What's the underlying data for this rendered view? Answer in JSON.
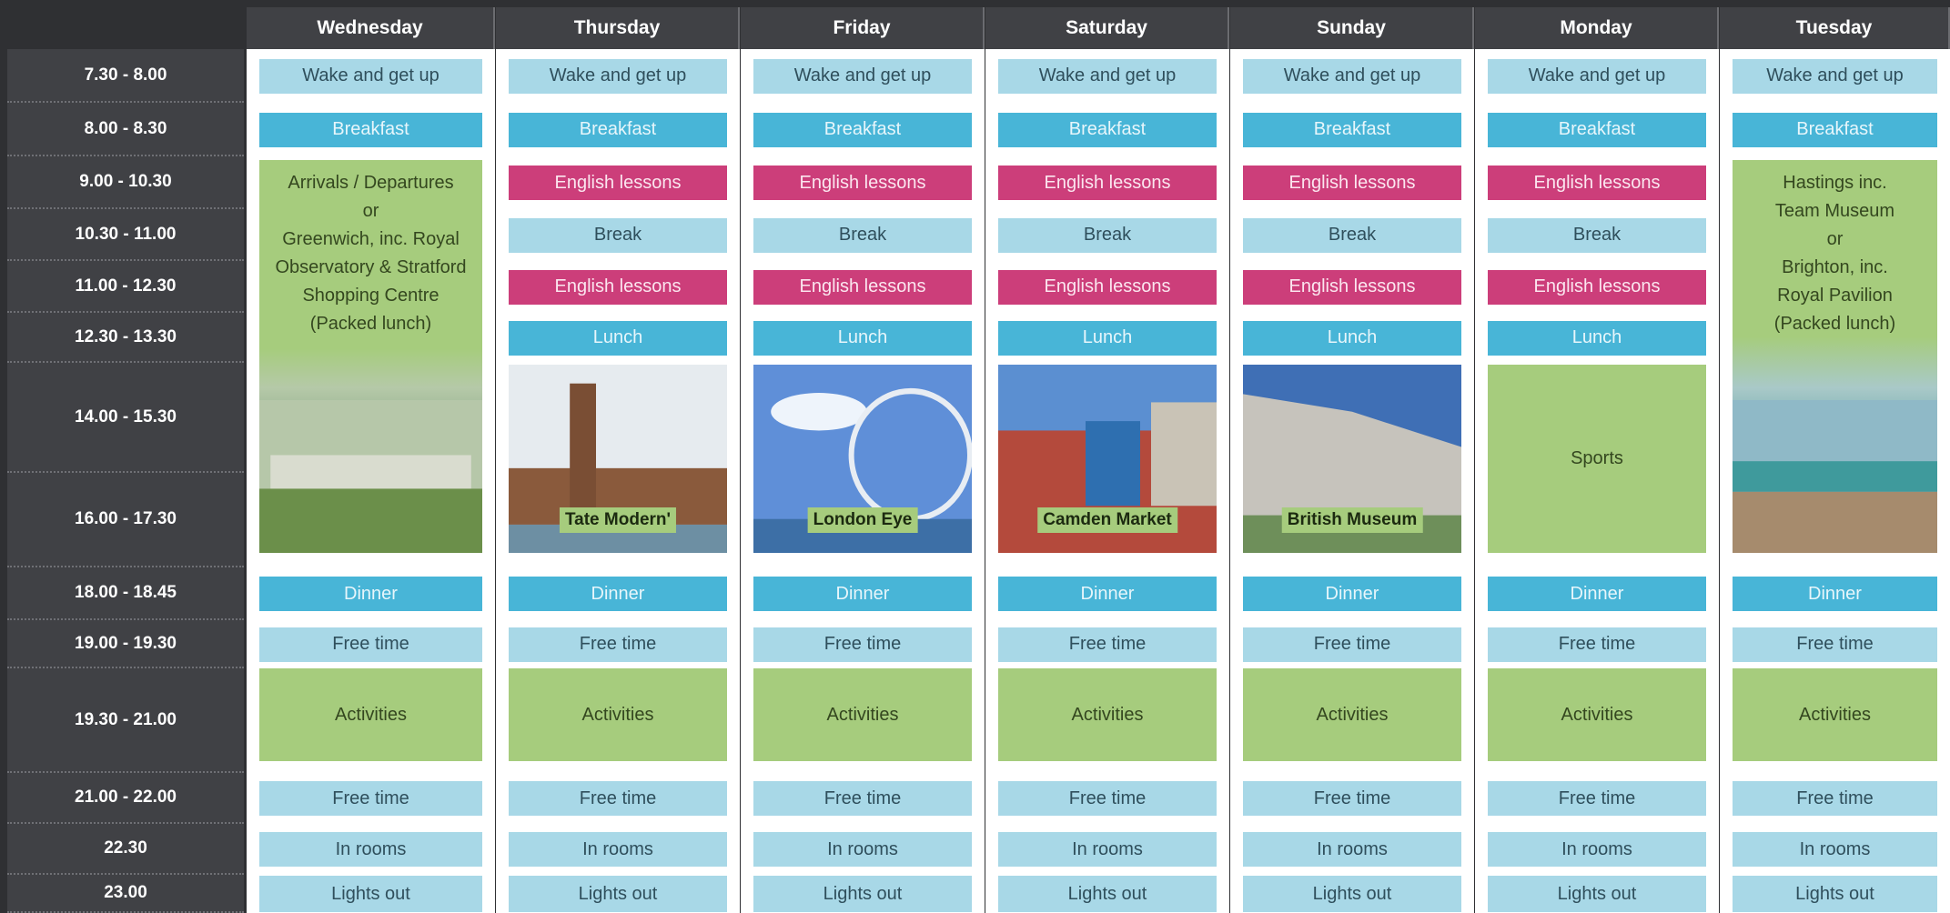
{
  "days": [
    "Wednesday",
    "Thursday",
    "Friday",
    "Saturday",
    "Sunday",
    "Monday",
    "Tuesday"
  ],
  "times": [
    "7.30 - 8.00",
    "8.00 - 8.30",
    "9.00 - 10.30",
    "10.30 - 11.00",
    "11.00 - 12.30",
    "12.30 - 13.30",
    "14.00 - 15.30",
    "16.00 - 17.30",
    "18.00 - 18.45",
    "19.00 - 19.30",
    "19.30 - 21.00",
    "21.00 - 22.00",
    "22.30",
    "23.00"
  ],
  "activities": {
    "wake": "Wake and get up",
    "breakfast": "Breakfast",
    "english": "English lessons",
    "break": "Break",
    "lunch": "Lunch",
    "dinner": "Dinner",
    "free_time": "Free time",
    "activities": "Activities",
    "in_rooms": "In rooms",
    "lights_out": "Lights out",
    "sports": "Sports"
  },
  "excursions": {
    "wednesday": [
      "Arrivals / Departures",
      "or",
      "Greenwich, inc. Royal",
      "Observatory & Stratford",
      "Shopping Centre",
      "(Packed lunch)"
    ],
    "tuesday": [
      "Hastings inc.",
      "Team Museum",
      "or",
      "Brighton, inc.",
      "Royal Pavilion",
      "(Packed lunch)"
    ]
  },
  "visits": {
    "thursday": "Tate Modern'",
    "friday": "London Eye",
    "saturday": "Camden Market",
    "sunday": "British Museum"
  },
  "colors": {
    "background": "#2f3033",
    "header": "#404145",
    "pale_blue": "#a8d8e7",
    "blue": "#48b5d7",
    "pink": "#cc3e7a",
    "green": "#a6cc7d"
  },
  "icons": {
    "thursday": "tate-modern-photo",
    "friday": "london-eye-photo",
    "saturday": "camden-market-photo",
    "sunday": "british-museum-photo",
    "wednesday": "greenwich-photo",
    "tuesday": "seaside-town-photo"
  }
}
